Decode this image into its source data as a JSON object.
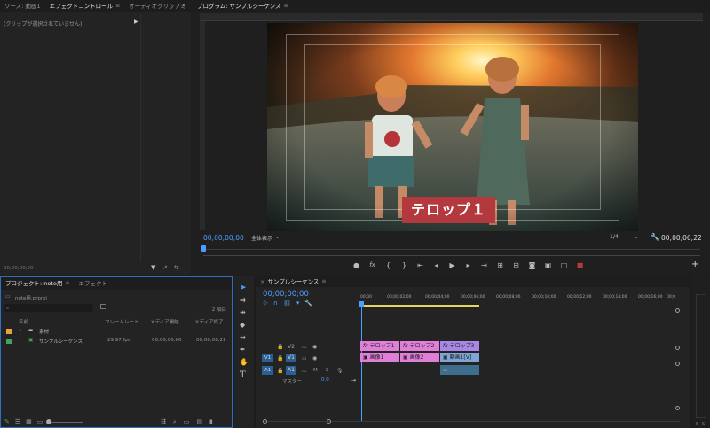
{
  "source_panel": {
    "tabs": [
      {
        "label": "ソース: 動画1",
        "active": false
      },
      {
        "label": "エフェクトコントロール",
        "active": true
      },
      {
        "label": "オーディオクリップミ",
        "active": false
      }
    ],
    "empty_message": "(クリップが選択されていません)",
    "timecode": "00;00;00;00"
  },
  "program_monitor": {
    "title": "プログラム: サンプルシーケンス",
    "caption": "テロップ１",
    "timecode_current": "00;00;00;00",
    "fit_label": "全体表示",
    "resolution_label": "1/4",
    "timecode_duration": "00;00;06;22"
  },
  "project_panel": {
    "tabs": [
      {
        "label": "プロジェクト: note用",
        "active": true
      },
      {
        "label": "エフェクト",
        "active": false
      }
    ],
    "project_file": "note用.prproj",
    "item_count": "2 項目",
    "columns": [
      "名前",
      "フレームレート",
      "メディア開始",
      "メディア終了"
    ],
    "items": [
      {
        "name": "素材",
        "type": "bin",
        "color": "#e8a33c",
        "framerate": "",
        "start": "",
        "end": ""
      },
      {
        "name": "サンプルシーケンス",
        "type": "sequence",
        "color": "#3fa55a",
        "framerate": "29.97 fps",
        "start": "00;00;00;00",
        "end": "00;00;06;21"
      }
    ]
  },
  "timeline": {
    "tab_label": "サンプルシーケンス",
    "timecode": "00;00;00;00",
    "ruler_labels": [
      "00;00",
      "00;00;02;00",
      "00;00;04;00",
      "00;00;06;00",
      "00;00;08;00",
      "00;00;10;00",
      "00;00;12;00",
      "00;00;14;00",
      "00;00;16;00",
      "00;0"
    ],
    "tracks": [
      {
        "name": "V2",
        "target": "",
        "label": ""
      },
      {
        "name": "V1",
        "target": "V1",
        "label": ""
      },
      {
        "name": "A1",
        "target": "A1",
        "label": ""
      }
    ],
    "master_label": "マスター",
    "master_value": "0.0",
    "mute_label": "M",
    "solo_label": "S",
    "clips_v2": [
      "テロップ1",
      "テロップ2",
      "テロップ3"
    ],
    "clips_v1": [
      "画像1",
      "画像2",
      "動画1[V]"
    ],
    "meter_labels": [
      "S",
      "S"
    ]
  },
  "colors": {
    "accent_blue": "#4d9fff",
    "clip_pink": "#e07fd8",
    "clip_purple": "#a987e6",
    "clip_blue": "#7fa5d6",
    "audio_clip": "#3d6f8c"
  }
}
